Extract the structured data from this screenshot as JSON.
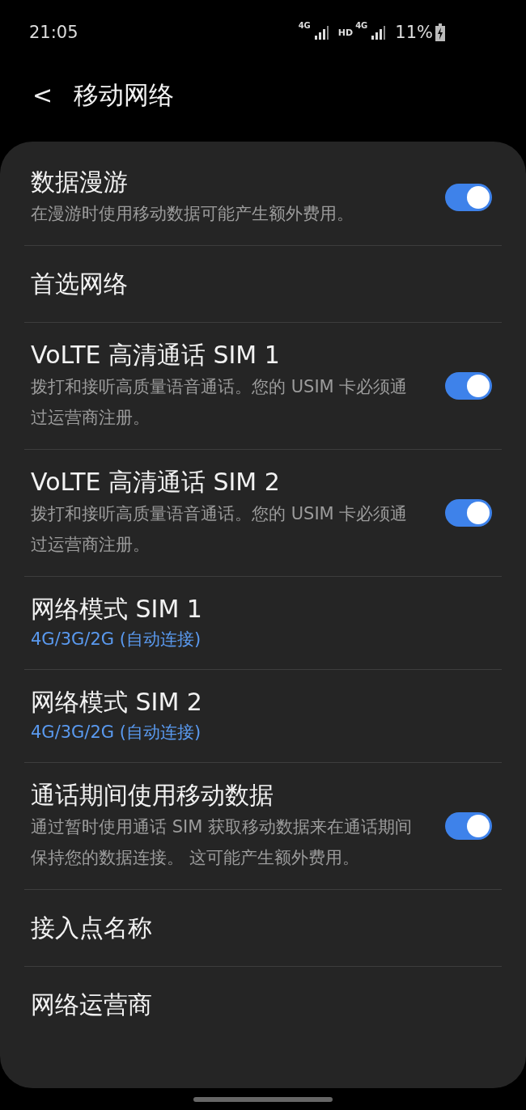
{
  "status_bar": {
    "time": "21:05",
    "sim_1_network": "4G",
    "hd": "HD",
    "sim_2_network": "4G",
    "battery": "11%"
  },
  "header": {
    "back": "<",
    "title": "移动网络"
  },
  "items": [
    {
      "title": "数据漫游",
      "subtitle": "在漫游时使用移动数据可能产生额外费用。",
      "on": true
    },
    {
      "title": "首选网络"
    },
    {
      "title": "VoLTE 高清通话 SIM 1",
      "subtitle": "拨打和接听高质量语音通话。您的 USIM 卡必须通过运营商注册。",
      "on": true
    },
    {
      "title": "VoLTE 高清通话 SIM 2",
      "subtitle": "拨打和接听高质量语音通话。您的 USIM 卡必须通过运营商注册。",
      "on": true
    },
    {
      "title": "网络模式 SIM 1",
      "value": "4G/3G/2G (自动连接)"
    },
    {
      "title": "网络模式 SIM 2",
      "value": "4G/3G/2G (自动连接)"
    },
    {
      "title": "通话期间使用移动数据",
      "subtitle": "通过暂时使用通话 SIM 获取移动数据来在通话期间保持您的数据连接。 这可能产生额外费用。",
      "on": true
    },
    {
      "title": "接入点名称"
    },
    {
      "title": "网络运营商"
    }
  ]
}
